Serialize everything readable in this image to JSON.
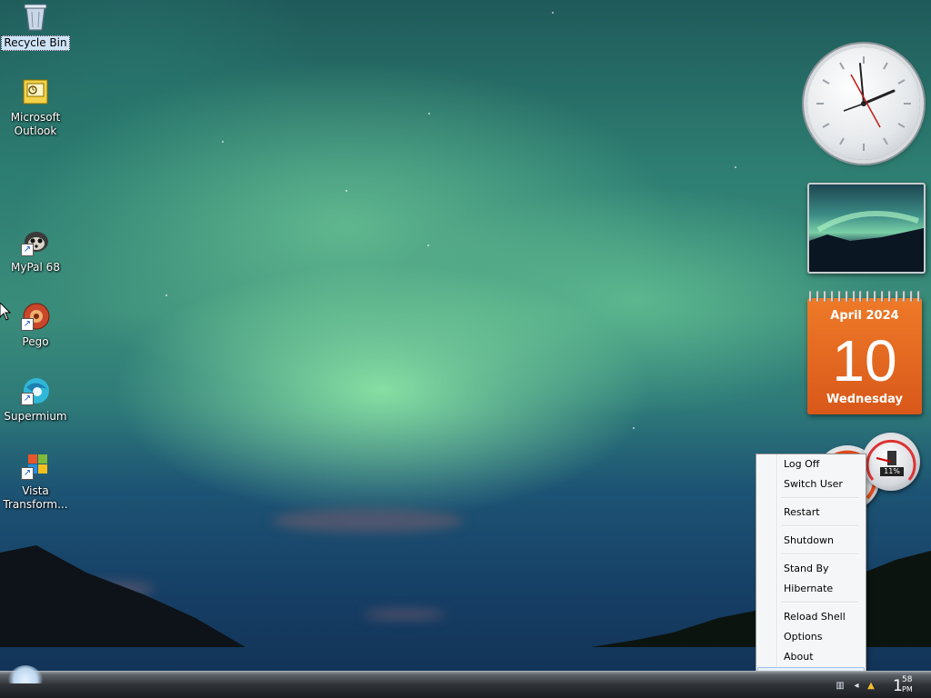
{
  "desktop_icons": [
    {
      "label": "Recycle Bin",
      "icon": "recycle-bin-icon",
      "selected": true
    },
    {
      "label": "Microsoft\nOutlook",
      "icon": "outlook-icon"
    },
    {
      "label": "MyPal 68",
      "icon": "mypal-icon"
    },
    {
      "label": "Pego",
      "icon": "pego-icon"
    },
    {
      "label": "Supermium",
      "icon": "supermium-icon"
    },
    {
      "label": "Vista\nTransform...",
      "icon": "vista-transform-icon"
    }
  ],
  "gadgets": {
    "calendar": {
      "month_year": "April 2024",
      "day": "10",
      "weekday": "Wednesday"
    },
    "cpu_meter": {
      "memory_label": "11%"
    }
  },
  "context_menu": {
    "items": [
      "Log Off",
      "Switch User",
      "Restart",
      "Shutdown",
      "Stand By",
      "Hibernate",
      "Reload Shell",
      "Options",
      "About"
    ]
  },
  "taskbar": {
    "clock": {
      "hour": "1",
      "minute": "58",
      "ampm": "PM"
    }
  },
  "colors": {
    "calendar_orange": "#e2661f",
    "menu_background": "#f5f6f7",
    "menu_hover": "#c7dcf3"
  }
}
